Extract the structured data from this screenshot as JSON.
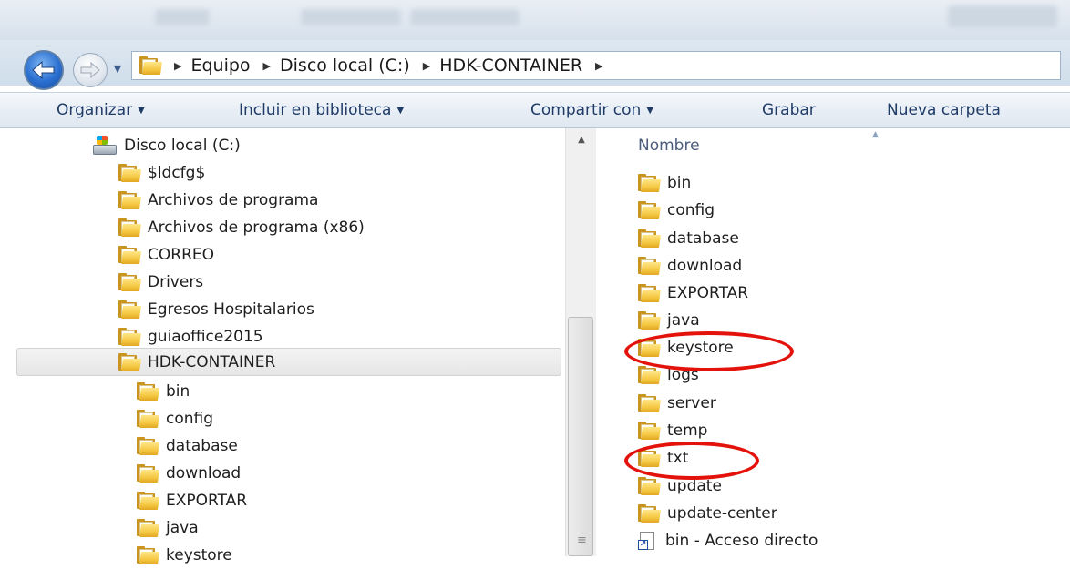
{
  "address": {
    "crumbs": [
      "Equipo",
      "Disco local (C:)",
      "HDK-CONTAINER"
    ],
    "separator_icon": "breadcrumb-arrow-icon"
  },
  "commandbar": {
    "organize": "Organizar",
    "include_in_library": "Incluir en biblioteca",
    "share_with": "Compartir con",
    "burn": "Grabar",
    "new_folder": "Nueva carpeta"
  },
  "navpane": {
    "drive": "Disco local (C:)",
    "root_items": [
      "$ldcfg$",
      "Archivos de programa",
      "Archivos de programa (x86)",
      "CORREO",
      "Drivers",
      "Egresos Hospitalarios",
      "guiaoffice2015",
      "HDK-CONTAINER"
    ],
    "selected": "HDK-CONTAINER",
    "children": [
      "bin",
      "config",
      "database",
      "download",
      "EXPORTAR",
      "java",
      "keystore"
    ]
  },
  "content": {
    "column_header": "Nombre",
    "items": [
      "bin",
      "config",
      "database",
      "download",
      "EXPORTAR",
      "java",
      "keystore",
      "logs",
      "server",
      "temp",
      "txt",
      "update",
      "update-center"
    ],
    "shortcut": "bin - Acceso directo"
  },
  "annotations": {
    "color": "#e3120b",
    "highlighted": [
      "keystore",
      "txt"
    ]
  },
  "colors": {
    "command_text": "#1f3b66",
    "header_text": "#4b5c7a",
    "folder_yellow": "#f5c842"
  }
}
